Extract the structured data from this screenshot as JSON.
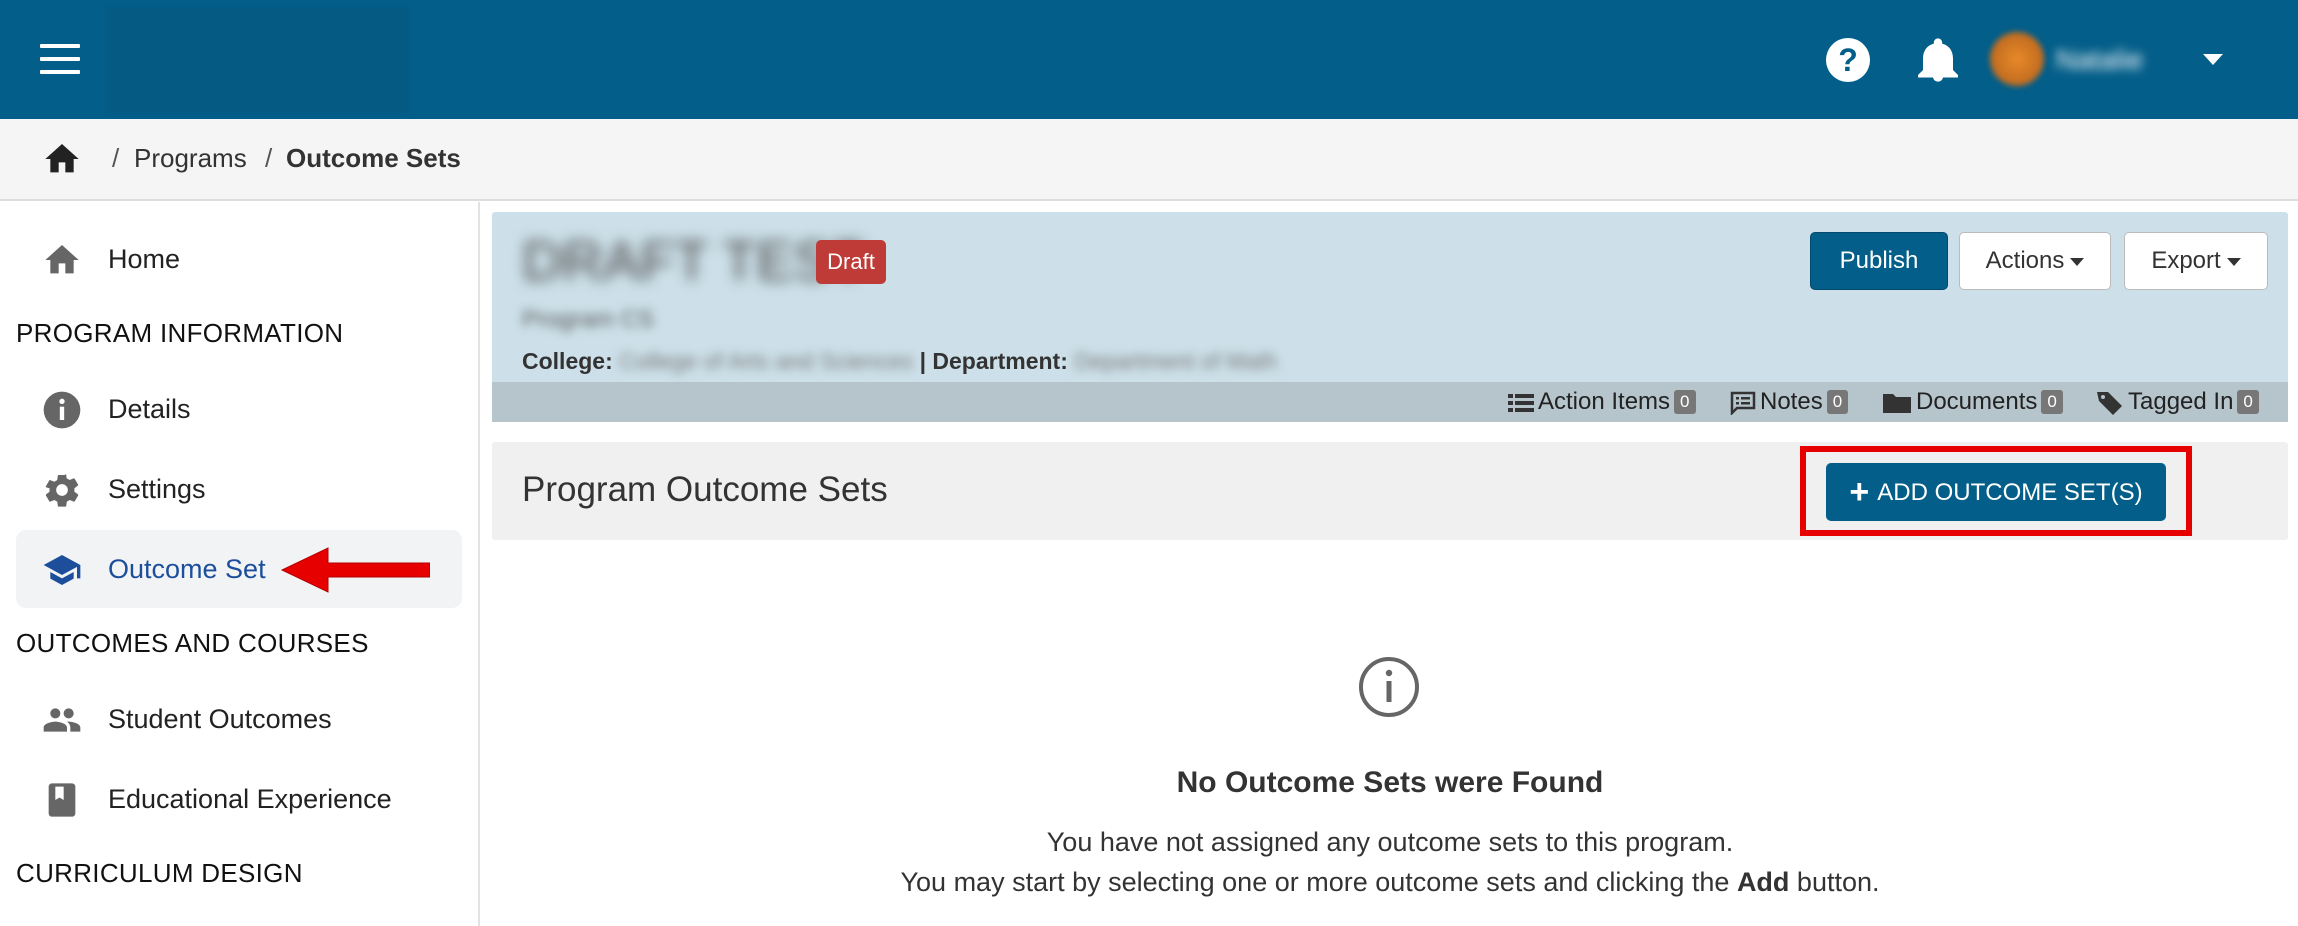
{
  "topbar": {
    "menu_icon": "hamburger-icon",
    "help_icon": "help-icon",
    "help_glyph": "?",
    "notifications_icon": "bell-icon",
    "user_name": "Natalie"
  },
  "breadcrumb": {
    "home_icon": "home-icon",
    "separator": "/",
    "items": [
      "Programs",
      "Outcome Sets"
    ]
  },
  "sidebar": {
    "items": [
      {
        "label": "Home",
        "icon": "home-icon"
      },
      {
        "label": "Details",
        "icon": "info-icon"
      },
      {
        "label": "Settings",
        "icon": "gear-icon"
      },
      {
        "label": "Outcome Set",
        "icon": "graduation-cap-icon",
        "active": true
      },
      {
        "label": "Student Outcomes",
        "icon": "people-icon"
      },
      {
        "label": "Educational Experience",
        "icon": "book-icon"
      }
    ],
    "sections": [
      "PROGRAM INFORMATION",
      "OUTCOMES AND COURSES",
      "CURRICULUM DESIGN"
    ]
  },
  "program": {
    "title": "DRAFT TEST",
    "status_badge": "Draft",
    "subtitle": "Program CS",
    "college_label": "College:",
    "college_value": "College of Arts and Sciences",
    "separator": "|",
    "department_label": "Department:",
    "department_value": "Department of Math",
    "buttons": {
      "publish": "Publish",
      "actions": "Actions",
      "export": "Export"
    },
    "meta": [
      {
        "label": "Action Items",
        "count": "0",
        "icon": "list-icon"
      },
      {
        "label": "Notes",
        "count": "0",
        "icon": "notes-icon"
      },
      {
        "label": "Documents",
        "count": "0",
        "icon": "folder-icon"
      },
      {
        "label": "Tagged In",
        "count": "0",
        "icon": "tag-icon"
      }
    ]
  },
  "outcome_sets": {
    "title": "Program Outcome Sets",
    "add_button": "ADD OUTCOME SET(S)",
    "add_plus": "+",
    "empty_icon": "info-circle-icon",
    "empty_title": "No Outcome Sets were Found",
    "empty_line1": "You have not assigned any outcome sets to this program.",
    "empty_line2_start": "You may start by selecting one or more outcome sets and clicking the ",
    "empty_line2_bold": "Add",
    "empty_line2_end": " button."
  },
  "colors": {
    "topbar": "#035e89",
    "primary_button": "#035e89",
    "draft_badge": "#bf3b37",
    "highlight": "#e60000",
    "active_nav_text": "#1c4e9c"
  }
}
